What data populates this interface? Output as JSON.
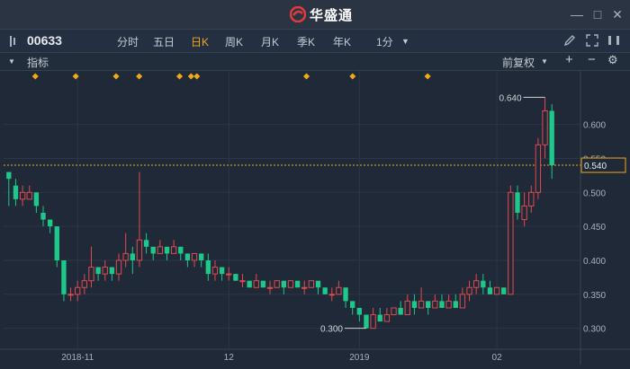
{
  "app": {
    "name": "华盛通"
  },
  "toolbar": {
    "symbol": "00633",
    "periods": [
      "分时",
      "五日",
      "日K",
      "周K",
      "月K",
      "季K",
      "年K",
      "1分"
    ],
    "active_period": "日K"
  },
  "indicator_bar": {
    "label": "指标",
    "adjust": "前复权"
  },
  "colors": {
    "up": "#e24a4f",
    "down": "#1ec88a",
    "accent": "#f0a81c",
    "bg": "#1f2937"
  },
  "chart_data": {
    "type": "candlestick",
    "y_ticks": [
      "0.600",
      "0.550",
      "0.500",
      "0.450",
      "0.400",
      "0.350",
      "0.300"
    ],
    "x_labels": [
      "2018-11",
      "12",
      "2019",
      "02"
    ],
    "ylim": [
      0.285,
      0.655
    ],
    "current_price": "0.540",
    "high_label": "0.640",
    "low_label": "0.300",
    "candles": [
      [
        0.53,
        0.52,
        0.53,
        0.48
      ],
      [
        0.51,
        0.49,
        0.52,
        0.48
      ],
      [
        0.49,
        0.5,
        0.51,
        0.48
      ],
      [
        0.49,
        0.5,
        0.51,
        0.49
      ],
      [
        0.5,
        0.48,
        0.5,
        0.47
      ],
      [
        0.47,
        0.46,
        0.48,
        0.45
      ],
      [
        0.46,
        0.45,
        0.46,
        0.44
      ],
      [
        0.45,
        0.4,
        0.45,
        0.39
      ],
      [
        0.4,
        0.35,
        0.4,
        0.34
      ],
      [
        0.35,
        0.35,
        0.36,
        0.34
      ],
      [
        0.35,
        0.36,
        0.37,
        0.34
      ],
      [
        0.36,
        0.37,
        0.38,
        0.35
      ],
      [
        0.37,
        0.39,
        0.42,
        0.36
      ],
      [
        0.39,
        0.38,
        0.39,
        0.37
      ],
      [
        0.38,
        0.39,
        0.4,
        0.37
      ],
      [
        0.39,
        0.38,
        0.39,
        0.37
      ],
      [
        0.38,
        0.4,
        0.41,
        0.37
      ],
      [
        0.4,
        0.41,
        0.44,
        0.39
      ],
      [
        0.41,
        0.4,
        0.42,
        0.38
      ],
      [
        0.4,
        0.43,
        0.53,
        0.39
      ],
      [
        0.43,
        0.42,
        0.44,
        0.41
      ],
      [
        0.42,
        0.41,
        0.42,
        0.4
      ],
      [
        0.41,
        0.42,
        0.43,
        0.41
      ],
      [
        0.42,
        0.41,
        0.42,
        0.4
      ],
      [
        0.41,
        0.42,
        0.43,
        0.41
      ],
      [
        0.42,
        0.41,
        0.42,
        0.4
      ],
      [
        0.41,
        0.4,
        0.41,
        0.39
      ],
      [
        0.4,
        0.41,
        0.41,
        0.39
      ],
      [
        0.41,
        0.4,
        0.41,
        0.39
      ],
      [
        0.4,
        0.38,
        0.41,
        0.37
      ],
      [
        0.38,
        0.39,
        0.4,
        0.37
      ],
      [
        0.39,
        0.38,
        0.39,
        0.37
      ],
      [
        0.38,
        0.38,
        0.39,
        0.37
      ],
      [
        0.38,
        0.37,
        0.38,
        0.37
      ],
      [
        0.37,
        0.37,
        0.38,
        0.36
      ],
      [
        0.37,
        0.36,
        0.37,
        0.36
      ],
      [
        0.36,
        0.37,
        0.38,
        0.36
      ],
      [
        0.37,
        0.36,
        0.37,
        0.36
      ],
      [
        0.36,
        0.36,
        0.37,
        0.35
      ],
      [
        0.36,
        0.37,
        0.37,
        0.36
      ],
      [
        0.37,
        0.36,
        0.37,
        0.35
      ],
      [
        0.36,
        0.37,
        0.37,
        0.36
      ],
      [
        0.37,
        0.36,
        0.37,
        0.36
      ],
      [
        0.36,
        0.36,
        0.37,
        0.35
      ],
      [
        0.36,
        0.37,
        0.37,
        0.36
      ],
      [
        0.37,
        0.36,
        0.37,
        0.35
      ],
      [
        0.36,
        0.35,
        0.36,
        0.35
      ],
      [
        0.35,
        0.35,
        0.36,
        0.34
      ],
      [
        0.35,
        0.36,
        0.37,
        0.35
      ],
      [
        0.36,
        0.34,
        0.36,
        0.33
      ],
      [
        0.34,
        0.33,
        0.34,
        0.32
      ],
      [
        0.33,
        0.32,
        0.33,
        0.31
      ],
      [
        0.32,
        0.3,
        0.32,
        0.3
      ],
      [
        0.3,
        0.32,
        0.33,
        0.3
      ],
      [
        0.32,
        0.31,
        0.33,
        0.31
      ],
      [
        0.31,
        0.32,
        0.33,
        0.31
      ],
      [
        0.32,
        0.33,
        0.33,
        0.32
      ],
      [
        0.33,
        0.32,
        0.34,
        0.32
      ],
      [
        0.32,
        0.34,
        0.35,
        0.32
      ],
      [
        0.34,
        0.33,
        0.35,
        0.32
      ],
      [
        0.33,
        0.34,
        0.36,
        0.33
      ],
      [
        0.34,
        0.33,
        0.34,
        0.32
      ],
      [
        0.33,
        0.34,
        0.35,
        0.33
      ],
      [
        0.34,
        0.33,
        0.35,
        0.33
      ],
      [
        0.33,
        0.34,
        0.35,
        0.33
      ],
      [
        0.34,
        0.33,
        0.35,
        0.33
      ],
      [
        0.33,
        0.35,
        0.36,
        0.33
      ],
      [
        0.35,
        0.36,
        0.37,
        0.34
      ],
      [
        0.36,
        0.37,
        0.38,
        0.35
      ],
      [
        0.37,
        0.36,
        0.38,
        0.35
      ],
      [
        0.36,
        0.35,
        0.37,
        0.35
      ],
      [
        0.35,
        0.36,
        0.36,
        0.35
      ],
      [
        0.36,
        0.35,
        0.36,
        0.35
      ],
      [
        0.35,
        0.5,
        0.51,
        0.35
      ],
      [
        0.5,
        0.47,
        0.51,
        0.46
      ],
      [
        0.46,
        0.48,
        0.5,
        0.45
      ],
      [
        0.48,
        0.5,
        0.51,
        0.47
      ],
      [
        0.5,
        0.57,
        0.58,
        0.49
      ],
      [
        0.57,
        0.62,
        0.64,
        0.55
      ],
      [
        0.62,
        0.54,
        0.63,
        0.52
      ]
    ],
    "markers": [
      0.055,
      0.125,
      0.195,
      0.235,
      0.305,
      0.325,
      0.335,
      0.525,
      0.605,
      0.735
    ]
  }
}
